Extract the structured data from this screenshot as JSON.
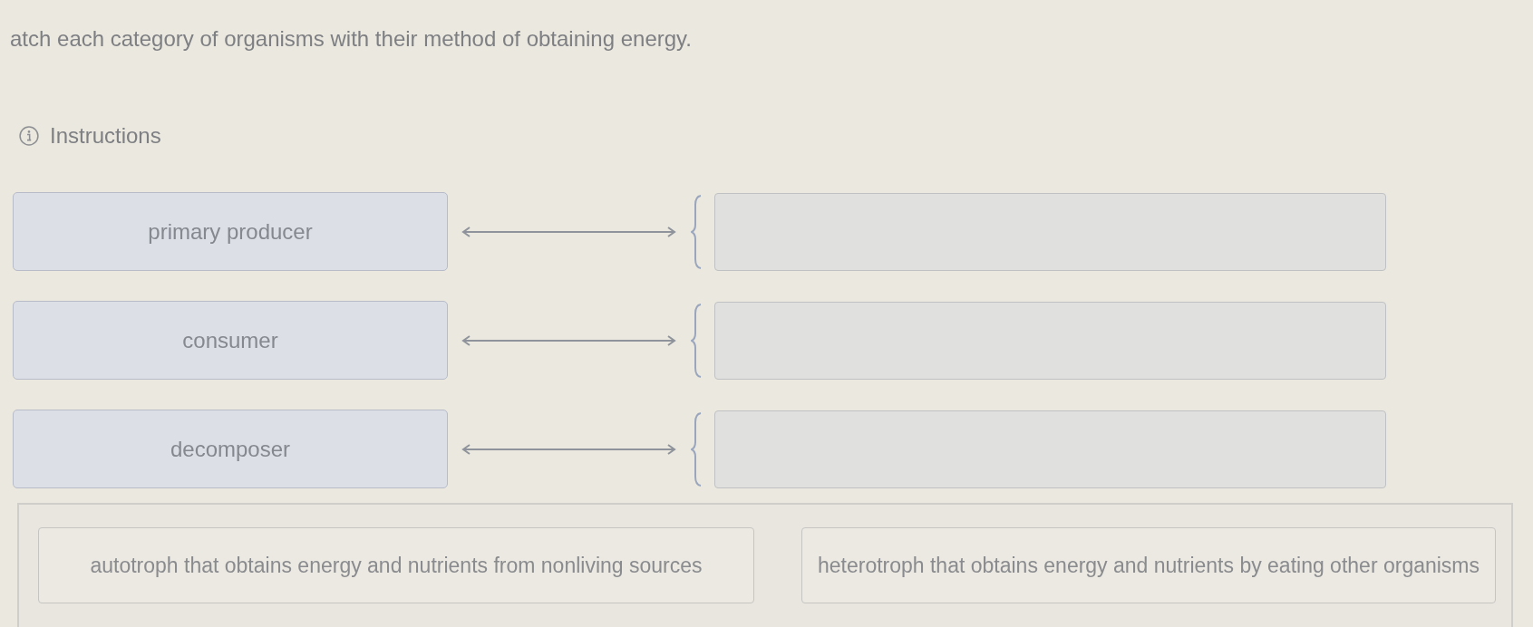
{
  "question": {
    "prompt": "atch each category of organisms with their method of obtaining energy.",
    "instructions_link": "Instructions"
  },
  "pairs": [
    {
      "term": "primary producer"
    },
    {
      "term": "consumer"
    },
    {
      "term": "decomposer"
    }
  ],
  "answer_bank": [
    {
      "text": "autotroph that obtains energy and nutrients from nonliving sources"
    },
    {
      "text": "heterotroph that obtains energy and nutrients by eating other organisms"
    }
  ]
}
